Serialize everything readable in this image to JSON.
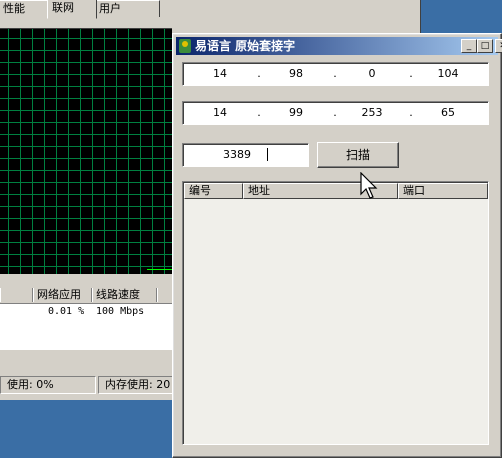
{
  "background_window": {
    "tabs": [
      "性能",
      "联网",
      "用户"
    ],
    "active_tab": "联网",
    "network_columns": [
      "",
      "网络应用",
      "线路速度",
      ""
    ],
    "network_row": {
      "utilization": "0.01 %",
      "speed": "100 Mbps"
    },
    "status": {
      "cpu": "使用: 0%",
      "memory": "内存使用: 20"
    }
  },
  "app_window": {
    "title": "易语言 原始套接字",
    "title_buttons": {
      "minimize": "_",
      "maximize": "□",
      "close": "✕"
    },
    "start_ip": [
      "14",
      "98",
      "0",
      "104"
    ],
    "end_ip": [
      "14",
      "99",
      "253",
      "65"
    ],
    "ip_separator": ".",
    "port_value": "3389",
    "scan_button": "扫描",
    "list_columns": [
      "编号",
      "地址",
      "端口"
    ]
  },
  "icons": {
    "app": "app-icon",
    "cursor": "mouse-pointer-icon"
  }
}
